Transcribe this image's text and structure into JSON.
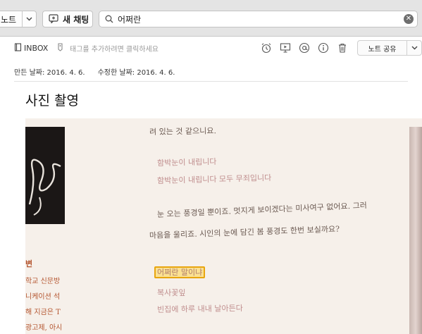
{
  "toolbar": {
    "notes_label": "노트",
    "new_chat_label": "새 채팅",
    "search_value": "어쩌란"
  },
  "note": {
    "notebook": "INBOX",
    "tag_placeholder": "태그를 추가하려면 클릭하세요",
    "share_label": "노트 공유",
    "created": "만든 날짜: 2016. 4. 6.",
    "modified": "수정한 날짜: 2016. 4. 6.",
    "title": "사진 촬영"
  },
  "photo_text": {
    "line1": "려 있는 것 같으니요.",
    "line2": "함박눈이 내립니다",
    "line3": "함박눈이 내립니다 모두 무죄입니다",
    "line4": "눈 오는 풍경일 뿐이죠. 멋지게 보이겠다는 미사여구 없어요. 그러",
    "line5": "마음을 울리죠. 시인의 눈에 담긴 봄 풍경도 한번 보실까요?",
    "highlight": "어쩌란 말이냐",
    "line7": "복사꽃잎",
    "line8": "빈집에 하루 내내 날아든다",
    "left1": "변",
    "left2": "학교 신문방",
    "left3": "니케이션 석",
    "left4": "해 지금은 T",
    "left5": "광고제, 아시"
  },
  "colors": {
    "toolbar_bg": "#e4e4e4",
    "highlight_fill": "#fbe192",
    "highlight_border": "#e8a50f"
  },
  "icons": [
    "chevron-down-icon",
    "new-chat-icon",
    "search-icon",
    "clear-icon",
    "notebook-icon",
    "tag-icon",
    "reminder-icon",
    "presentation-icon",
    "at-icon",
    "info-icon",
    "trash-icon"
  ]
}
